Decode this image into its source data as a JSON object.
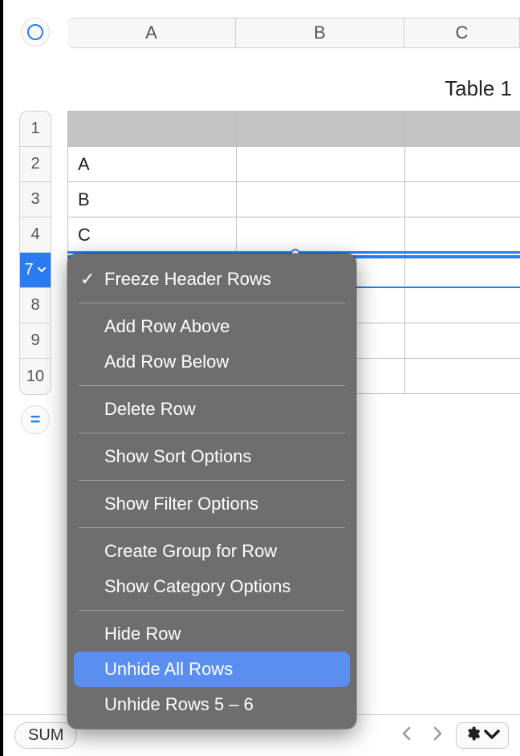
{
  "toolbar": {
    "table_reference_icon": "circle"
  },
  "columns": [
    "A",
    "B",
    "C"
  ],
  "table_title": "Table 1",
  "row_numbers": [
    "1",
    "2",
    "3",
    "4",
    "7",
    "8",
    "9",
    "10"
  ],
  "selected_row_index": 4,
  "hidden_rows_range": "5 – 6",
  "cells": {
    "r2": "A",
    "r3": "B",
    "r4": "C"
  },
  "context_menu": {
    "freeze_header_rows": "Freeze Header Rows",
    "freeze_checked": true,
    "add_row_above": "Add Row Above",
    "add_row_below": "Add Row Below",
    "delete_row": "Delete Row",
    "show_sort": "Show Sort Options",
    "show_filter": "Show Filter Options",
    "create_group": "Create Group for Row",
    "show_category": "Show Category Options",
    "hide_row": "Hide Row",
    "unhide_all": "Unhide All Rows",
    "unhide_range": "Unhide Rows 5 – 6",
    "highlighted": "unhide_all"
  },
  "bottom_bar": {
    "sum_label": "SUM"
  }
}
